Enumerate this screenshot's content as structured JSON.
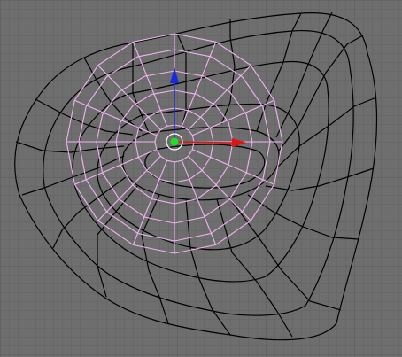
{
  "viewport": {
    "background": "#6e6e6e",
    "grid_color": "#636363",
    "grid_major_color": "#5a5a5a",
    "wire_color": "#000000",
    "selected_color": "#f0b4f0",
    "transform_widget": {
      "x_axis_color": "#e01414",
      "y_axis_color": "#1a28e6",
      "center_color": "#22dd22",
      "center_ring_color": "#ffffff"
    }
  }
}
